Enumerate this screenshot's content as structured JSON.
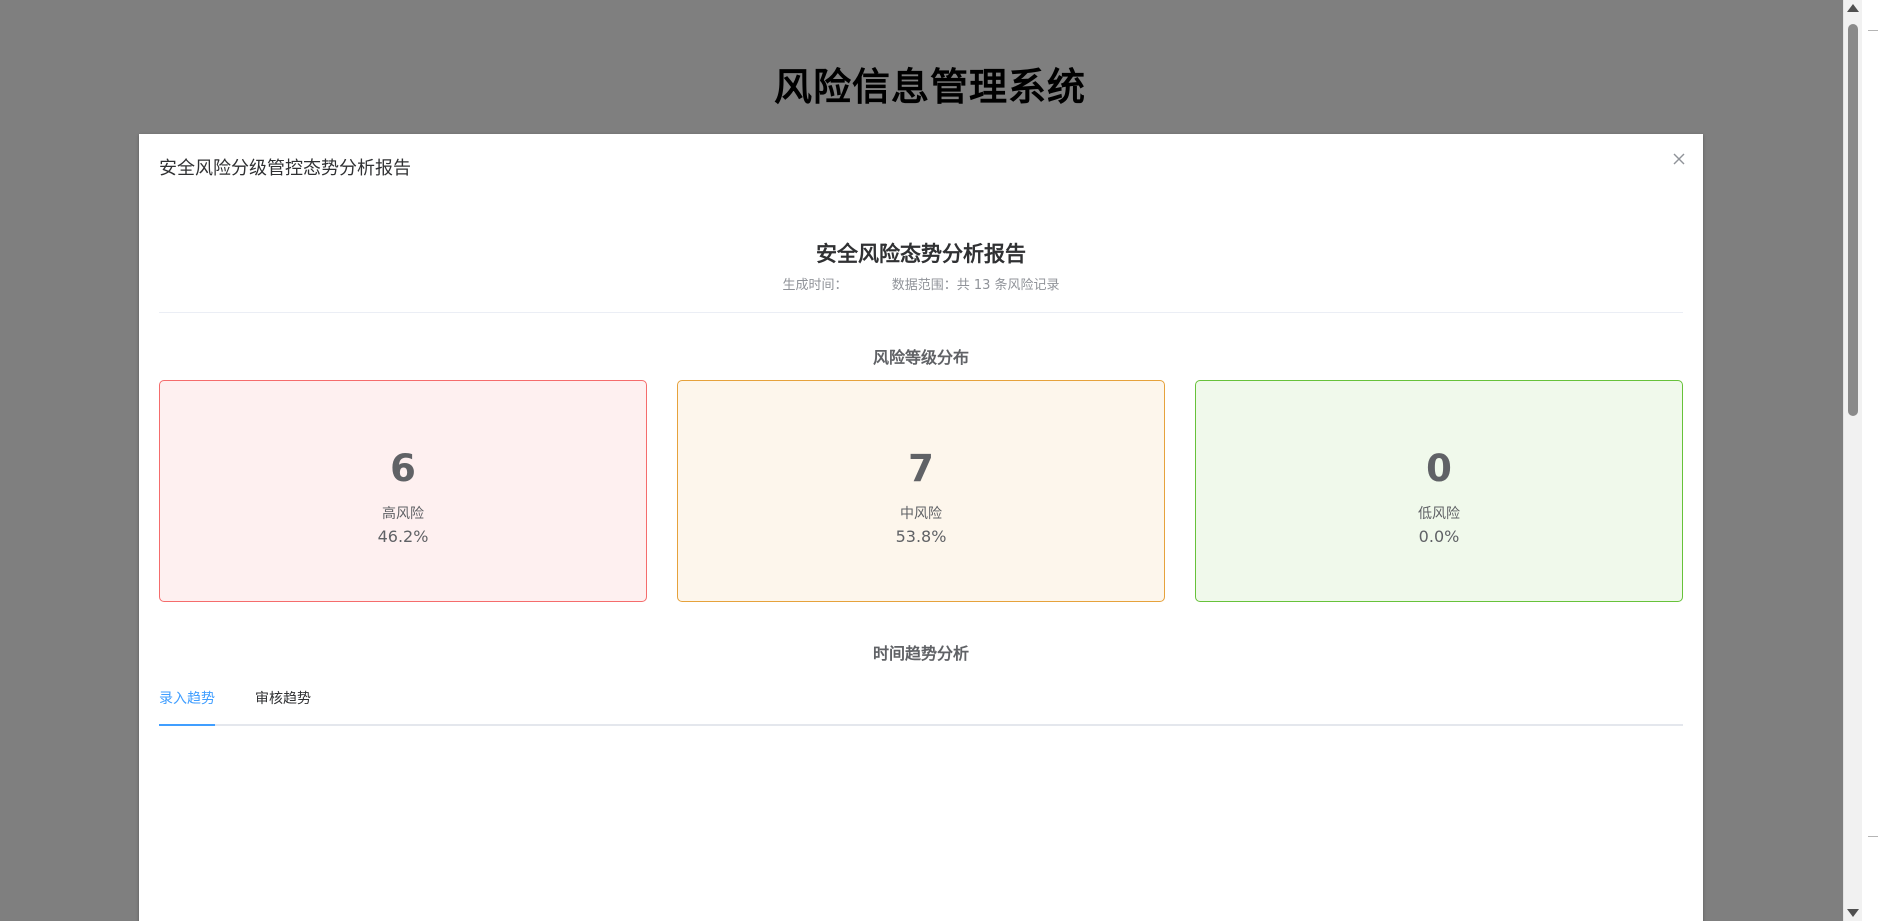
{
  "page": {
    "title": "风险信息管理系统"
  },
  "dialog": {
    "title": "安全风险分级管控态势分析报告",
    "close_icon": "close-icon"
  },
  "report": {
    "title": "安全风险态势分析报告",
    "generated_label": "生成时间：",
    "data_range": "数据范围：共 13 条风险记录"
  },
  "distribution": {
    "title": "风险等级分布",
    "cards": [
      {
        "count": "6",
        "label": "高风险",
        "percent": "46.2%",
        "color": "#f56c6c",
        "bg": "#fef0f0"
      },
      {
        "count": "7",
        "label": "中风险",
        "percent": "53.8%",
        "color": "#e6a23c",
        "bg": "#fdf6ec"
      },
      {
        "count": "0",
        "label": "低风险",
        "percent": "0.0%",
        "color": "#67c23a",
        "bg": "#f0f9eb"
      }
    ]
  },
  "trend": {
    "title": "时间趋势分析",
    "tabs": [
      {
        "label": "录入趋势",
        "active": true
      },
      {
        "label": "审核趋势",
        "active": false
      }
    ]
  },
  "colors": {
    "accent": "#409eff",
    "overlay": "rgba(0,0,0,0.5)"
  }
}
